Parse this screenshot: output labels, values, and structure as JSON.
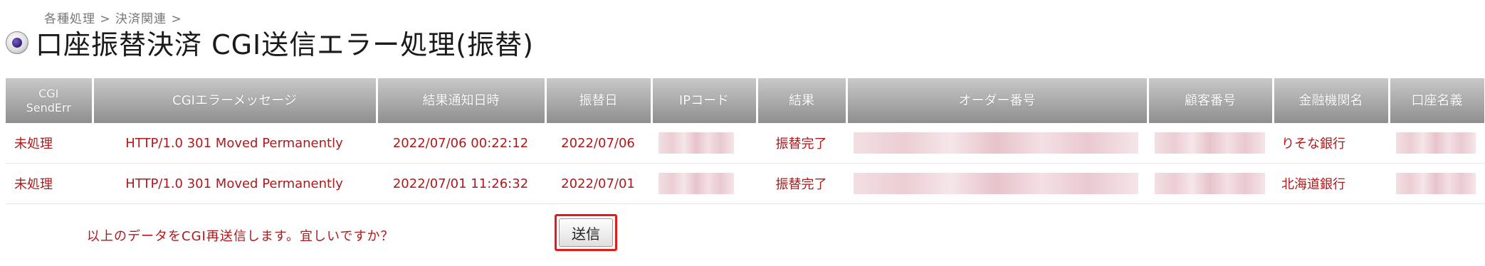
{
  "breadcrumb": "各種処理 > 決済関連 >",
  "title": "口座振替決済 CGI送信エラー処理(振替)",
  "table": {
    "headers": {
      "cgi_top": "CGI",
      "cgi_bottom": "SendErr",
      "message": "CGIエラーメッセージ",
      "notify": "結果通知日時",
      "transfer_date": "振替日",
      "ip_code": "IPコード",
      "result": "結果",
      "order_no": "オーダー番号",
      "customer_no": "顧客番号",
      "bank": "金融機関名",
      "account": "口座名義"
    },
    "rows": [
      {
        "status": "未処理",
        "message": "HTTP/1.0 301 Moved Permanently",
        "notify": "2022/07/06 00:22:12",
        "transfer_date": "2022/07/06",
        "result": "振替完了",
        "bank": "りそな銀行"
      },
      {
        "status": "未処理",
        "message": "HTTP/1.0 301 Moved Permanently",
        "notify": "2022/07/01 11:26:32",
        "transfer_date": "2022/07/01",
        "result": "振替完了",
        "bank": "北海道銀行"
      }
    ]
  },
  "confirm": {
    "text": "以上のデータをCGI再送信します。宜しいですか？",
    "send_label": "送信"
  },
  "colors": {
    "error_text": "#b0181a",
    "highlight": "#e8181b",
    "header_bg": "#8f8f8f"
  }
}
